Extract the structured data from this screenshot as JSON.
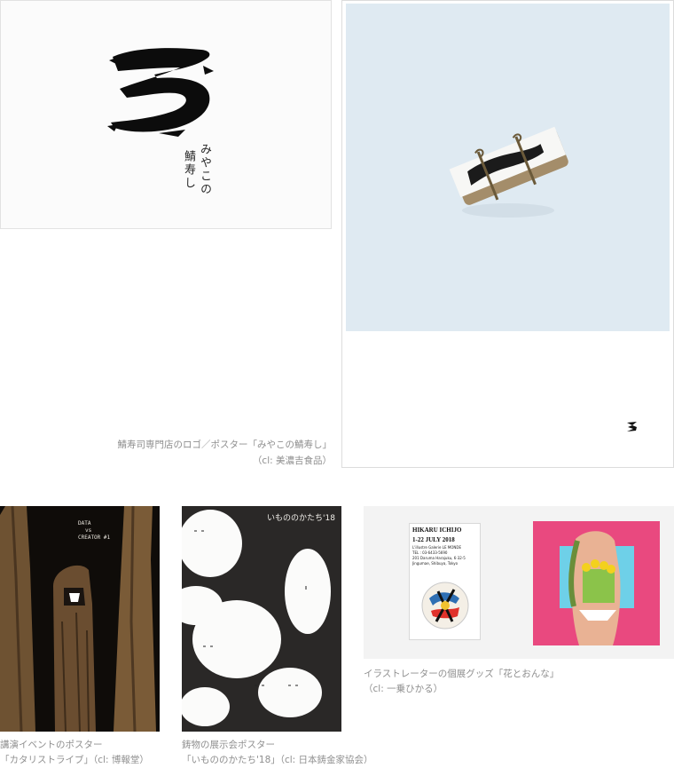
{
  "works": {
    "sabazushi": {
      "logo_text_col1": "みやこの",
      "logo_text_col2": "鯖寿し",
      "caption_line1": "鯖寿司専門店のロゴ／ポスター「みやこの鯖寿し」",
      "caption_line2": "（cl: 美濃吉食品）"
    },
    "catalyst": {
      "poster_title_line1": "DATA",
      "poster_title_line2": "vs",
      "poster_title_line3": "CREATOR #1",
      "caption_line1": "講演イベントのポスター",
      "caption_line2": "「カタリストライブ」（cl: 博報堂）"
    },
    "imono": {
      "poster_title": "いもののかたち'18",
      "caption_line1": "鋳物の展示会ポスター",
      "caption_line2": "「いもののかたち'18」（cl: 日本鋳金家協会）"
    },
    "hanato": {
      "card_name": "HIKARU ICHIJO",
      "card_dates": "1-22 JULY 2018",
      "card_venue": "L'illustre Galerie LE MONDE",
      "card_tel": "TEL : 03-6433-5690",
      "card_address1": "201 Daruma Harajuku, 6-32-5",
      "card_address2": "Jingumae, Shibuya, Tokyo",
      "caption_line1": "イラストレーターの個展グッズ「花とおんな」",
      "caption_line2": "（cl: 一乗ひかる）"
    }
  },
  "colors": {
    "caption": "#8f8f8f",
    "poster_sky": "#dfeaf2",
    "hanato_pink": "#e9497f",
    "hanato_blue": "#6ed0e8"
  }
}
